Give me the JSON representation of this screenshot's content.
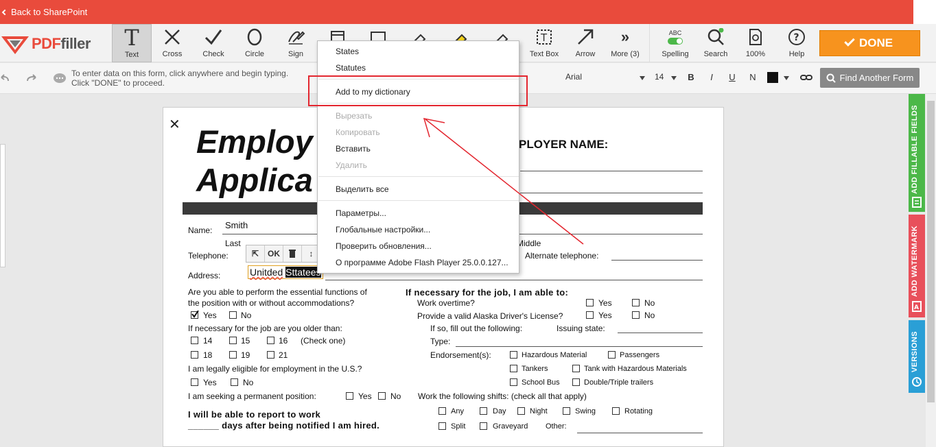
{
  "topbar": {
    "back_label": "Back to SharePoint"
  },
  "logo": {
    "brand_pdf": "PDF",
    "brand_filler": "filler"
  },
  "tools": [
    {
      "name": "Text",
      "icon": "text-icon"
    },
    {
      "name": "Cross",
      "icon": "cross-icon"
    },
    {
      "name": "Check",
      "icon": "check-icon"
    },
    {
      "name": "Circle",
      "icon": "circle-icon"
    },
    {
      "name": "Sign",
      "icon": "sign-icon"
    },
    {
      "name": "Text Box",
      "icon": "textbox-icon"
    },
    {
      "name": "Arrow",
      "icon": "arrow-icon"
    },
    {
      "name": "More (3)",
      "icon": "more-icon"
    },
    {
      "name": "Spelling",
      "icon": "spelling-toggle-icon",
      "badge": "ABC"
    },
    {
      "name": "Search",
      "icon": "search-icon"
    },
    {
      "name": "100%",
      "icon": "zoom-icon"
    },
    {
      "name": "Help",
      "icon": "help-icon"
    }
  ],
  "done_label": "DONE",
  "subbar": {
    "hint_line1": "To enter data on this form, click anywhere and begin typing.",
    "hint_line2": "Click \"DONE\" to proceed.",
    "font": "Arial",
    "size": "14",
    "bold": "B",
    "italic": "I",
    "underline": "U",
    "normal": "N",
    "find_label": "Find Another Form"
  },
  "form": {
    "title_line1": "Employ",
    "title_line2": "Applica",
    "employer_label": "PLOYER NAME:",
    "name_label": "Name:",
    "name_value": "Smith",
    "last_label": "Last",
    "middle_label": "Middle",
    "telephone_label": "Telephone:",
    "alt_phone_label": "Alternate telephone:",
    "address_label": "Address:",
    "typed_word1": "Unitded",
    "typed_word2": "Sttatees",
    "essential_q1": "Are you able to perform the essential functions of",
    "essential_q2": "the position with or without accommodations?",
    "yes": "Yes",
    "no": "No",
    "older_q": "If necessary for the job are you older than:",
    "ages": [
      "14",
      "15",
      "16",
      "18",
      "19",
      "21"
    ],
    "check_one": "(Check one)",
    "eligible_q": "I am legally eligible for employment in the U.S.?",
    "permanent_q": "I am seeking a permanent position:",
    "report_q1": "I will be able to report to work",
    "report_q2": "______ days after being notified I am hired.",
    "able_header": "If necessary for the job, I am able to:",
    "overtime": "Work overtime?",
    "license": "Provide a valid Alaska Driver's License?",
    "fill_following": "If so, fill out the following:",
    "issuing_state": "Issuing state:",
    "type_label": "Type:",
    "endorsements_label": "Endorsement(s):",
    "endorsements": [
      "Hazardous Material",
      "Passengers",
      "Tankers",
      "Tank with Hazardous Materials",
      "School Bus",
      "Double/Triple trailers"
    ],
    "shifts_q": "Work the following shifts: (check all that apply)",
    "shifts": [
      "Any",
      "Day",
      "Night",
      "Swing",
      "Rotating",
      "Split",
      "Graveyard"
    ],
    "other_label": "Other:",
    "ok_label": "OK"
  },
  "context_menu": {
    "items": [
      {
        "label": "States",
        "disabled": false
      },
      {
        "label": "Statutes",
        "disabled": false
      },
      {
        "label": "Add to my dictionary",
        "disabled": false
      },
      {
        "label": "Вырезать",
        "disabled": true
      },
      {
        "label": "Копировать",
        "disabled": true
      },
      {
        "label": "Вставить",
        "disabled": false
      },
      {
        "label": "Удалить",
        "disabled": true
      },
      {
        "label": "Выделить все",
        "disabled": false
      },
      {
        "label": "Параметры...",
        "disabled": false
      },
      {
        "label": "Глобальные настройки...",
        "disabled": false
      },
      {
        "label": "Проверить обновления...",
        "disabled": false
      },
      {
        "label": "О программе Adobe Flash Player 25.0.0.127...",
        "disabled": false
      }
    ]
  },
  "side_tabs": {
    "fillable": "ADD FILLABLE FIELDS",
    "watermark": "ADD WATERMARK",
    "versions": "VERSIONS"
  },
  "colors": {
    "topbar": "#e94b3c",
    "done": "#f7931e",
    "fillable_tab": "#4cb849",
    "watermark_tab": "#e8505b",
    "versions_tab": "#2a9fd6",
    "annotation": "#e3262f"
  }
}
